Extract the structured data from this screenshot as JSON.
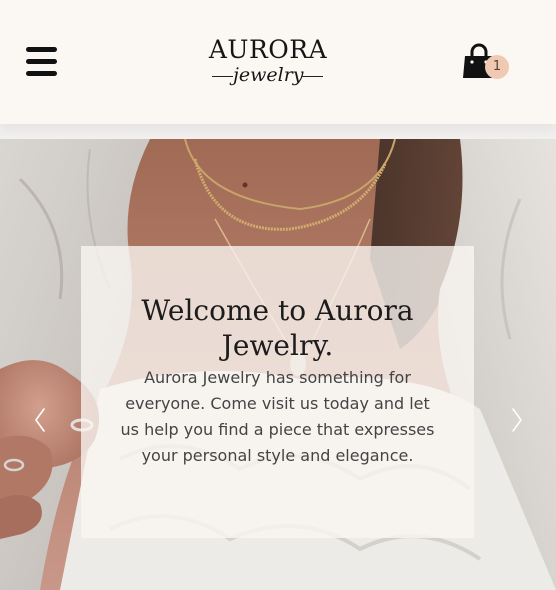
{
  "header": {
    "menu_icon": "hamburger-menu-icon",
    "logo": {
      "title": "AURORA",
      "subtitle": "jewelry"
    },
    "cart": {
      "icon": "shopping-bag-icon",
      "count": "1"
    }
  },
  "hero": {
    "title": "Welcome to Aurora Jewelry.",
    "text": "Aurora Jewelry has something for everyone. Come visit us today and let us help you find a piece that expresses your personal style and elegance.",
    "prev_icon": "chevron-left-icon",
    "next_icon": "chevron-right-icon"
  },
  "colors": {
    "header_bg": "#fbf8f4",
    "cart_badge": "#efc9b2",
    "card_bg": "#faf6f2",
    "text_dark": "#1c1c1c",
    "text_body": "#444444"
  }
}
